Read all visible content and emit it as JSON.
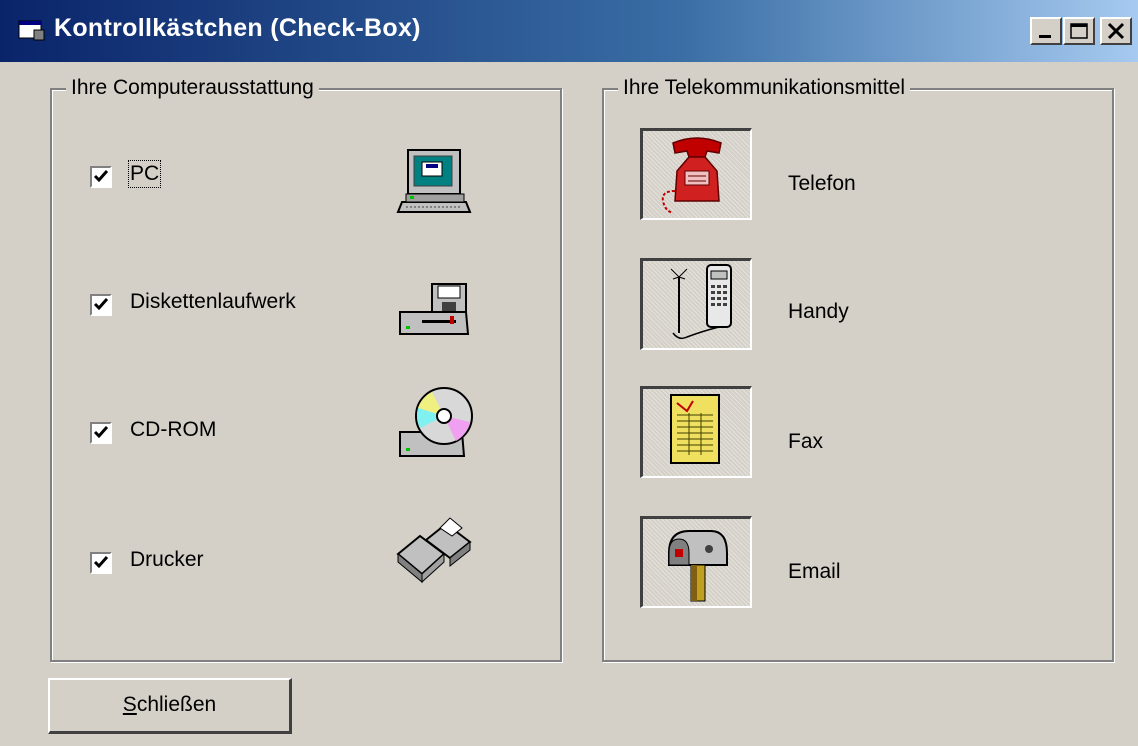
{
  "window": {
    "title": "Kontrollkästchen (Check-Box)",
    "title_icon": "app-window-icon",
    "controls": [
      "minimize-icon",
      "maximize-icon",
      "close-icon"
    ]
  },
  "computer_group": {
    "legend": "Ihre Computerausstattung",
    "items": [
      {
        "label": "PC",
        "checked": true,
        "icon": "pc-icon"
      },
      {
        "label": "Diskettenlaufwerk",
        "checked": true,
        "icon": "floppy-drive-icon"
      },
      {
        "label": "CD-ROM",
        "checked": true,
        "icon": "cd-rom-icon"
      },
      {
        "label": "Drucker",
        "checked": true,
        "icon": "printer-icon"
      }
    ]
  },
  "telecom_group": {
    "legend": "Ihre Telekommunikationsmittel",
    "items": [
      {
        "label": "Telefon",
        "icon": "telephone-icon"
      },
      {
        "label": "Handy",
        "icon": "mobile-phone-icon"
      },
      {
        "label": "Fax",
        "icon": "fax-icon"
      },
      {
        "label": "Email",
        "icon": "mailbox-icon"
      }
    ]
  },
  "close_button": {
    "label_first": "S",
    "label_rest": "chließen"
  },
  "colors": {
    "titlebar_start": "#0a246a",
    "titlebar_end": "#a6caf0",
    "face": "#d4d0c8"
  }
}
